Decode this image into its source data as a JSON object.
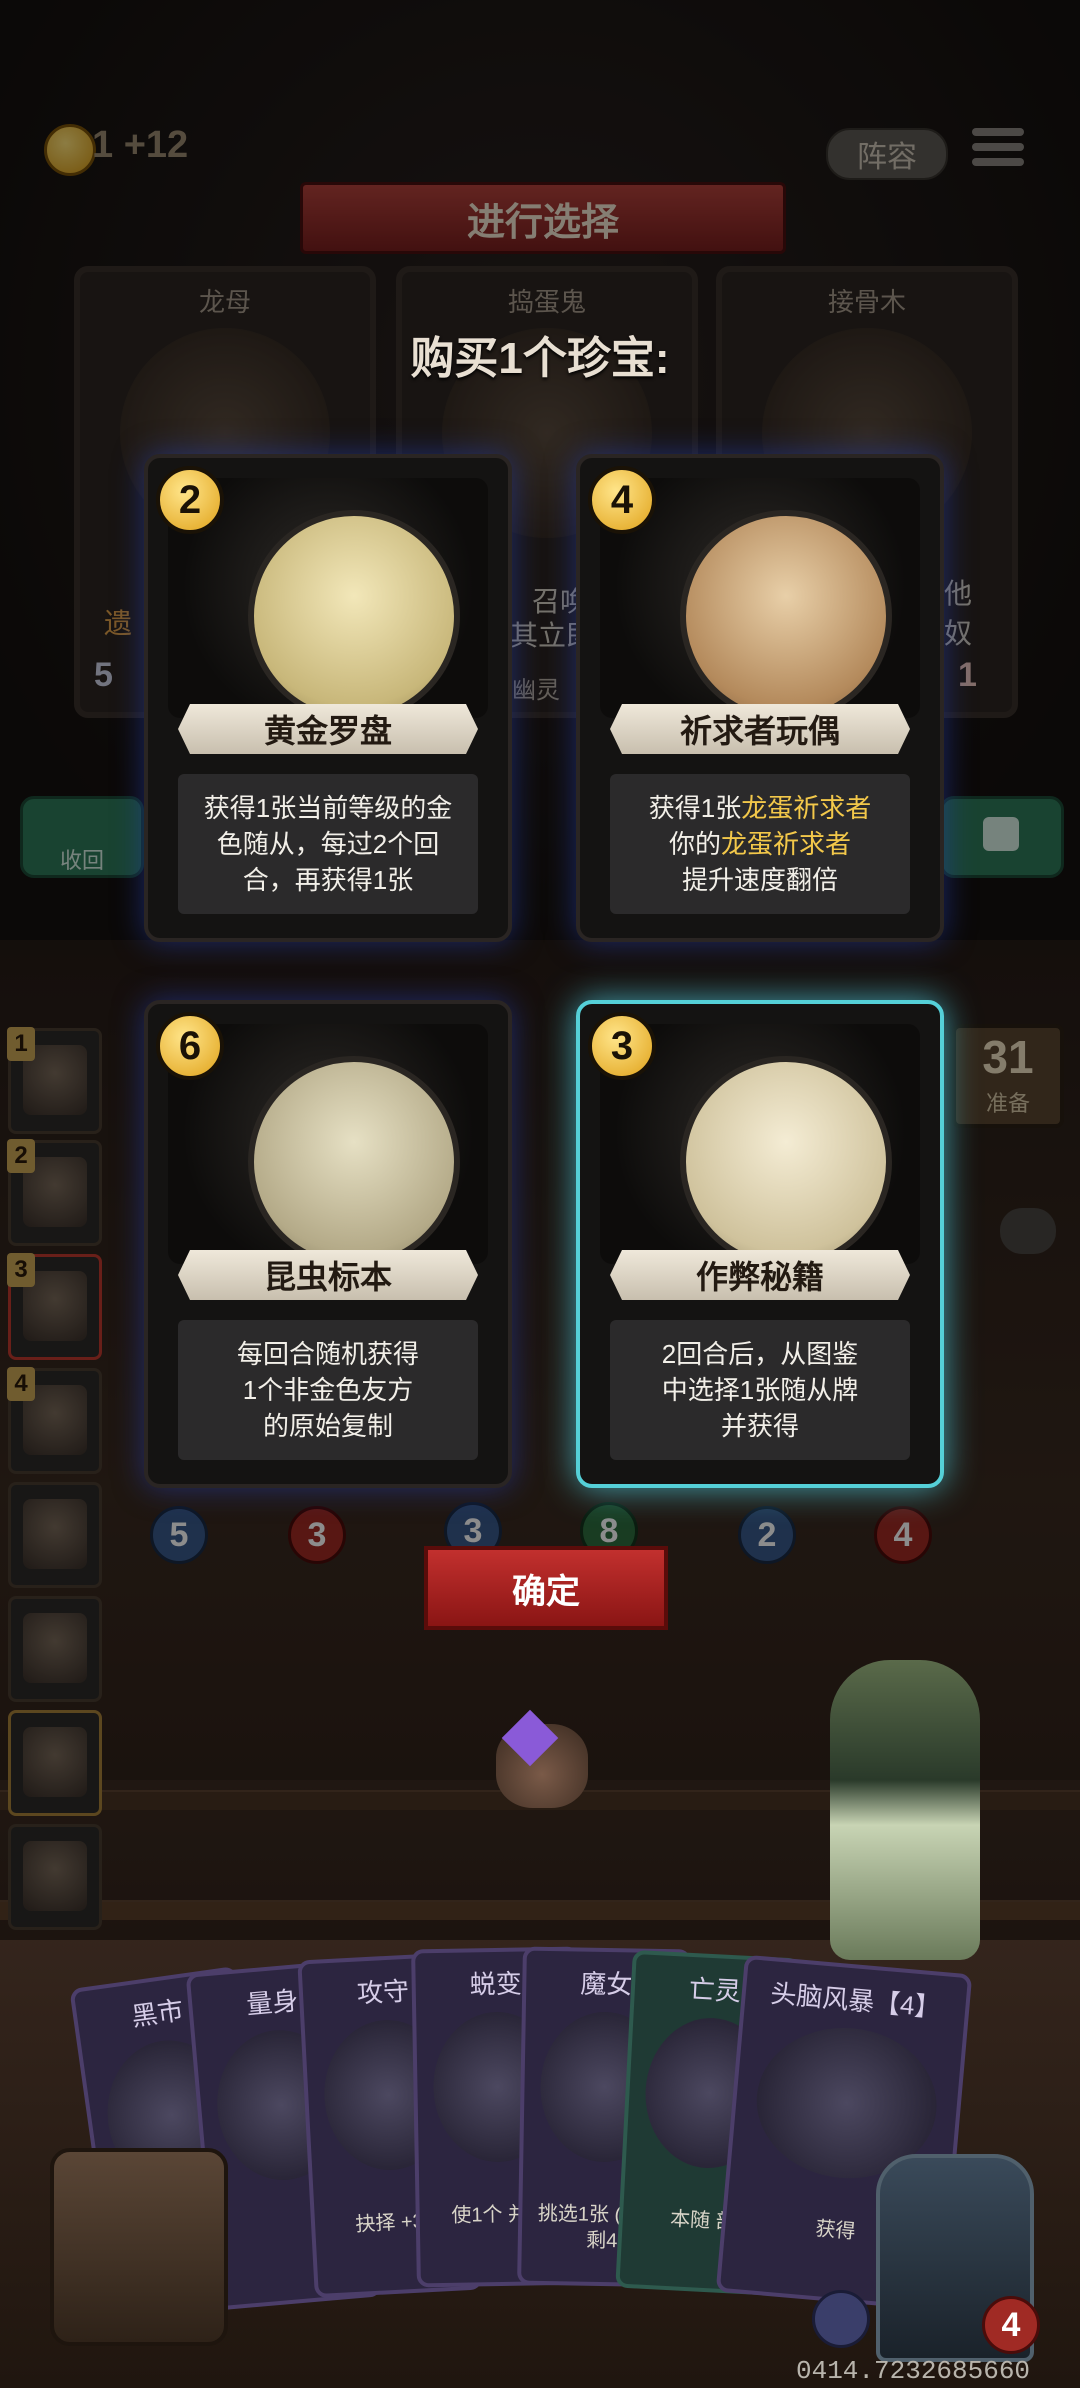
{
  "header": {
    "gold": "1",
    "gold_income": "+12",
    "lineup_label": "阵容"
  },
  "banner": {
    "title": "进行选择",
    "subtitle": "购买1个珍宝:"
  },
  "shop_minions": [
    {
      "name": "龙母",
      "fragment": "遗",
      "corner": "5"
    },
    {
      "name": "捣蛋鬼",
      "fragment_a": "召唤",
      "fragment_b": "其立即",
      "tribe": "幽灵"
    },
    {
      "name": "接骨木",
      "fragment": "他 奴",
      "corner": "1"
    }
  ],
  "side_buttons": {
    "recall_label": "收回"
  },
  "treasures": [
    {
      "cost": "2",
      "name": "黄金罗盘",
      "lines": [
        "获得1张当前等级的金",
        "色随从，每过2个回",
        "合，再获得1张"
      ],
      "icon": "compass-icon"
    },
    {
      "cost": "4",
      "name": "祈求者玩偶",
      "line1_pre": "获得1张",
      "line1_hl": "龙蛋祈求者",
      "line2_pre": "你的",
      "line2_hl": "龙蛋祈求者",
      "line3": "提升速度翻倍",
      "icon": "wooden-doll-icon"
    },
    {
      "cost": "6",
      "name": "昆虫标本",
      "lines": [
        "每回合随机获得",
        "1个非金色友方",
        "的原始复制"
      ],
      "icon": "bug-jar-icon"
    },
    {
      "cost": "3",
      "name": "作弊秘籍",
      "lines": [
        "2回合后，从图鉴",
        "中选择1张随从牌",
        "并获得"
      ],
      "icon": "scroll-icon"
    }
  ],
  "confirm_label": "确定",
  "prep": {
    "count": "31",
    "label": "准备"
  },
  "roster_tiers": [
    "1",
    "2",
    "3",
    "4"
  ],
  "board_stats": [
    {
      "atk": "5",
      "hp": "3"
    },
    {
      "atk": "3",
      "hp": "8"
    },
    {
      "atk": "2",
      "hp": "4"
    }
  ],
  "hand_cards": [
    {
      "name": "黑市",
      "text": ""
    },
    {
      "name": "量身",
      "text": ""
    },
    {
      "name": "攻守",
      "text": "抉择 +35"
    },
    {
      "name": "蜕变",
      "text": "使1个 并变"
    },
    {
      "name": "魔女",
      "text": "挑选1张 (生 仅剩4"
    },
    {
      "name": "亡灵",
      "text": "本随 部"
    },
    {
      "name": "头脑风暴【4】",
      "text": "获得"
    }
  ],
  "hero": {
    "hp": "4"
  },
  "footer_code": "0414.7232685660",
  "colors": {
    "gold": "#e0a21a",
    "highlight": "#f3c84a",
    "confirm": "#b3221f",
    "selected_glow": "#55d0d8"
  }
}
